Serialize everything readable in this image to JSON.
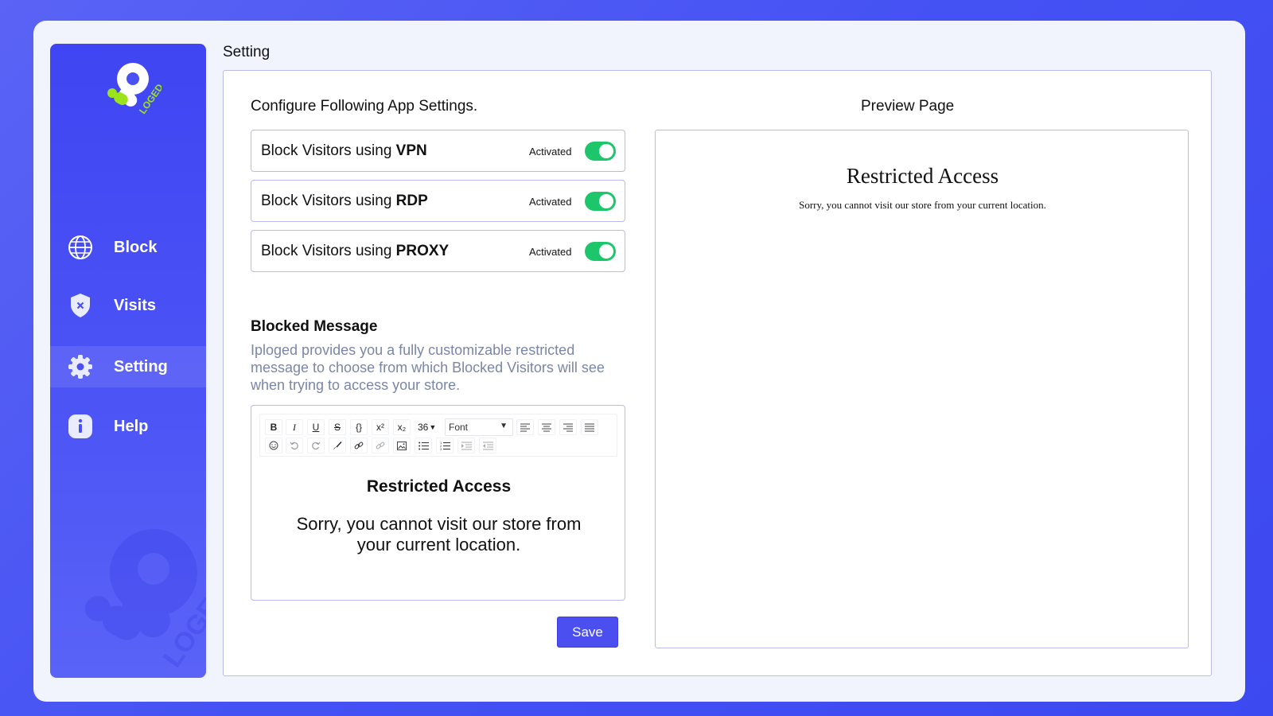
{
  "sidebar": {
    "logo_text": "LOGED",
    "items": [
      {
        "label": "Block",
        "icon": "globe-icon"
      },
      {
        "label": "Visits",
        "icon": "shield-icon"
      },
      {
        "label": "Setting",
        "icon": "gear-icon",
        "active": true
      },
      {
        "label": "Help",
        "icon": "info-icon"
      }
    ]
  },
  "page": {
    "title": "Setting"
  },
  "settings": {
    "heading": "Configure Following App Settings.",
    "toggles": [
      {
        "prefix": "Block Visitors using ",
        "keyword": "VPN",
        "status": "Activated",
        "on": true
      },
      {
        "prefix": "Block Visitors using ",
        "keyword": "RDP",
        "status": "Activated",
        "on": true
      },
      {
        "prefix": "Block Visitors using ",
        "keyword": "PROXY",
        "status": "Activated",
        "on": true
      }
    ],
    "blocked_heading": "Blocked Message",
    "blocked_desc": "Iploged provides you a fully customizable restricted message  to choose from which Blocked Visitors will see when trying to access your store."
  },
  "editor": {
    "toolbar": {
      "bold": "B",
      "italic": "I",
      "underline": "U",
      "strike": "S",
      "code": "{}",
      "superscript": "x²",
      "subscript": "x₂",
      "font_size": "36",
      "font": "Font"
    },
    "content_heading": "Restricted Access",
    "content_body": "Sorry, you cannot visit our store from your current location."
  },
  "save_label": "Save",
  "preview": {
    "title": "Preview Page",
    "heading": "Restricted Access",
    "body": "Sorry, you cannot visit our store from your current location."
  },
  "colors": {
    "background": "#4451f3",
    "sidebar": "#3f45f2",
    "toggle_on": "#1ec66b",
    "button": "#4c4ff0",
    "description": "#7b86a6"
  }
}
